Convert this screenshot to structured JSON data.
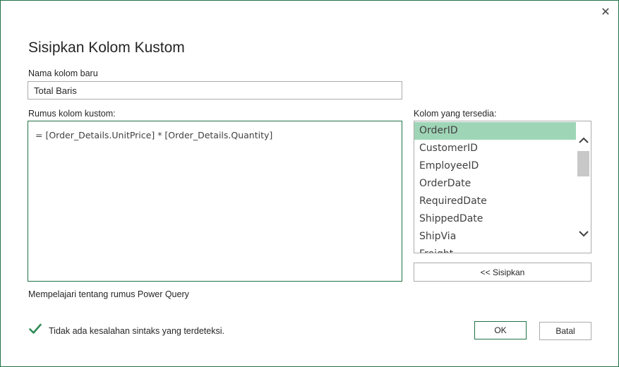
{
  "dialog": {
    "title": "Sisipkan Kolom Kustom",
    "close_glyph": "✕"
  },
  "name_field": {
    "label": "Nama kolom baru",
    "value": "Total Baris"
  },
  "formula": {
    "label": "Rumus kolom kustom:",
    "text": "=  [Order_Details.UnitPrice] * [Order_Details.Quantity]"
  },
  "columns": {
    "label": "Kolom yang tersedia:",
    "items": [
      "OrderID",
      "CustomerID",
      "EmployeeID",
      "OrderDate",
      "RequiredDate",
      "ShippedDate",
      "ShipVia",
      "Freight"
    ],
    "selected_index": 0
  },
  "buttons": {
    "insert": "<< Sisipkan",
    "ok": "OK",
    "cancel": "Batal"
  },
  "learn_link": "Mempelajari tentang rumus Power Query",
  "status": {
    "text": "Tidak ada kesalahan sintaks yang terdeteksi.",
    "icon": "checkmark-icon"
  },
  "colors": {
    "accent": "#217346",
    "selection": "#9fd5b7",
    "check": "#2e8b57"
  }
}
